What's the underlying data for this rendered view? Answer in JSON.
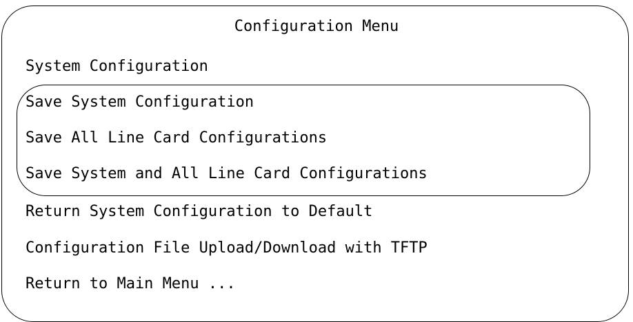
{
  "menu": {
    "title": "Configuration Menu",
    "items": [
      {
        "label": "System Configuration",
        "selected": false
      },
      {
        "label": "Save System Configuration",
        "selected": true
      },
      {
        "label": "Save All Line Card Configurations",
        "selected": true
      },
      {
        "label": "Save System and All Line Card Configurations",
        "selected": true
      },
      {
        "label": "Return System Configuration to Default",
        "selected": false
      },
      {
        "label": "Configuration File Upload/Download with TFTP",
        "selected": false
      },
      {
        "label": "Return to Main Menu ...",
        "selected": false
      }
    ]
  },
  "colors": {
    "background": "#ffffff",
    "text": "#000000",
    "border": "#000000"
  }
}
